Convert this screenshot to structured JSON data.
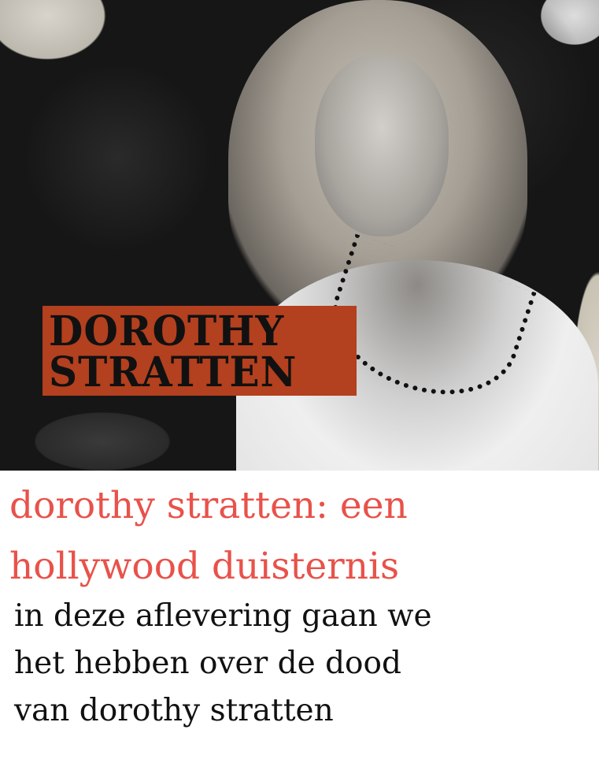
{
  "cover": {
    "label_lines": [
      "DOROTHY",
      "STRATTEN"
    ],
    "label_color": "#b3401e"
  },
  "title": {
    "lines": [
      "dorothy stratten: een",
      "hollywood duisternis"
    ],
    "color": "#e8524a"
  },
  "description": {
    "lines": [
      "in deze aflevering gaan we",
      "het hebben over de dood",
      "van dorothy stratten"
    ]
  }
}
